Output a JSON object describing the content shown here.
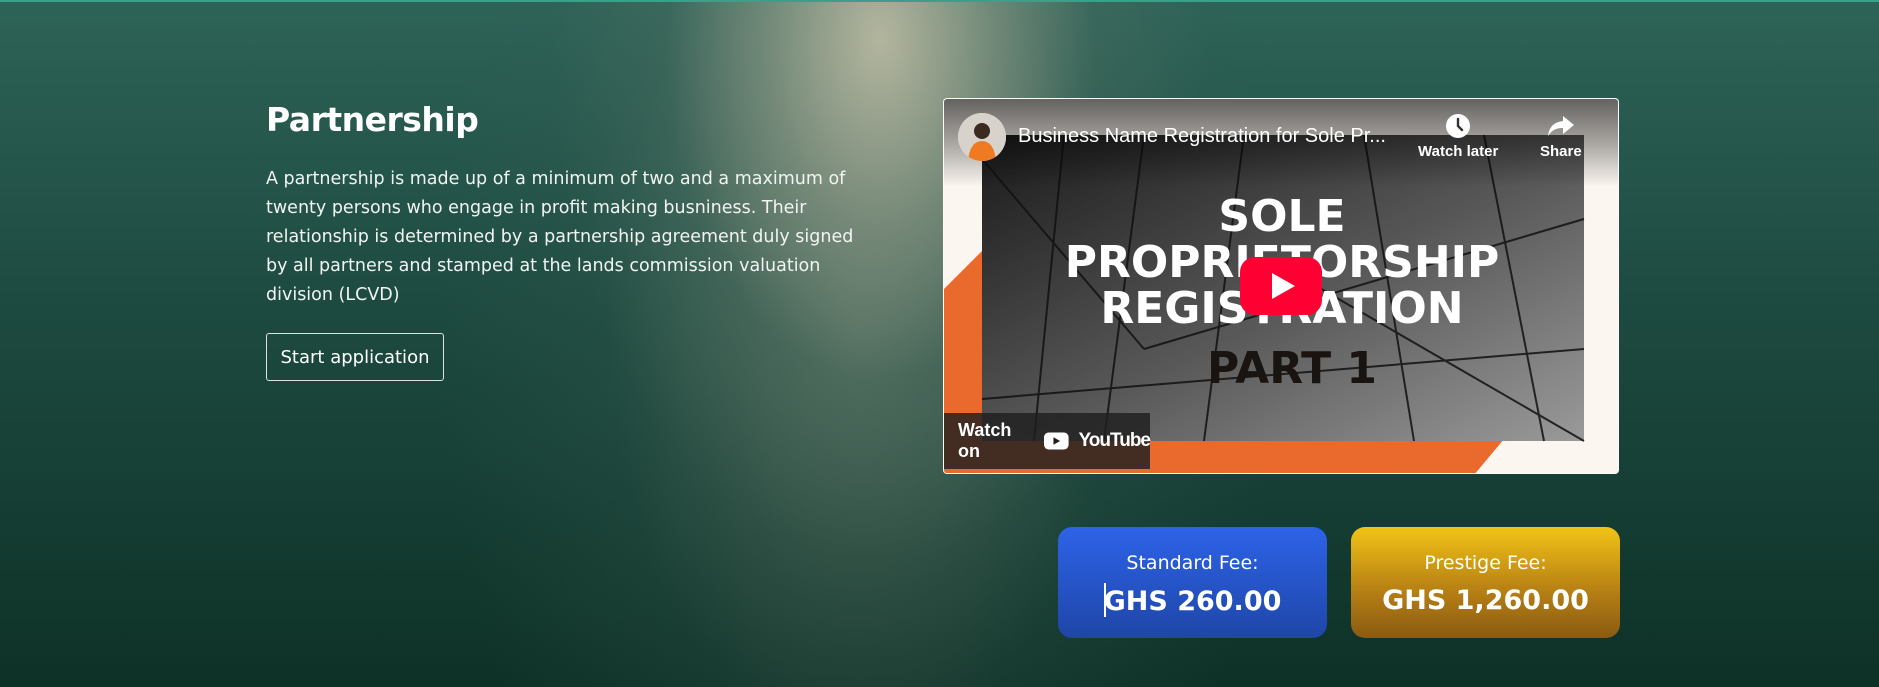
{
  "section": {
    "title": "Partnership",
    "description": "A partnership is made up of a minimum of two and a maximum of twenty persons who engage in profit making busniness. Their relationship is determined by a partnership agreement duly signed by all partners and stamped at the lands commission valuation division (LCVD)",
    "start_button_label": "Start application"
  },
  "video": {
    "title": "Business Name Registration for Sole Pr...",
    "watch_later_label": "Watch later",
    "share_label": "Share",
    "watch_on_label": "Watch on",
    "youtube_label": "YouTube",
    "thumbnail_text": {
      "line1": "SOLE",
      "line2": "PROPRIETORSHIP",
      "line3": "REGISTRATION",
      "line4": "PART 1"
    }
  },
  "fees": {
    "standard": {
      "label": "Standard Fee:",
      "amount": "GHS 260.00"
    },
    "prestige": {
      "label": "Prestige Fee:",
      "amount": "GHS 1,260.00"
    }
  },
  "colors": {
    "standard_fee_bg": "#2d63e8",
    "prestige_fee_bg": "#d9a014",
    "youtube_red": "#ff0033",
    "thumbnail_orange": "#ea6a2e"
  },
  "icons": [
    "clock-icon",
    "share-icon",
    "play-icon",
    "youtube-logo-icon"
  ]
}
